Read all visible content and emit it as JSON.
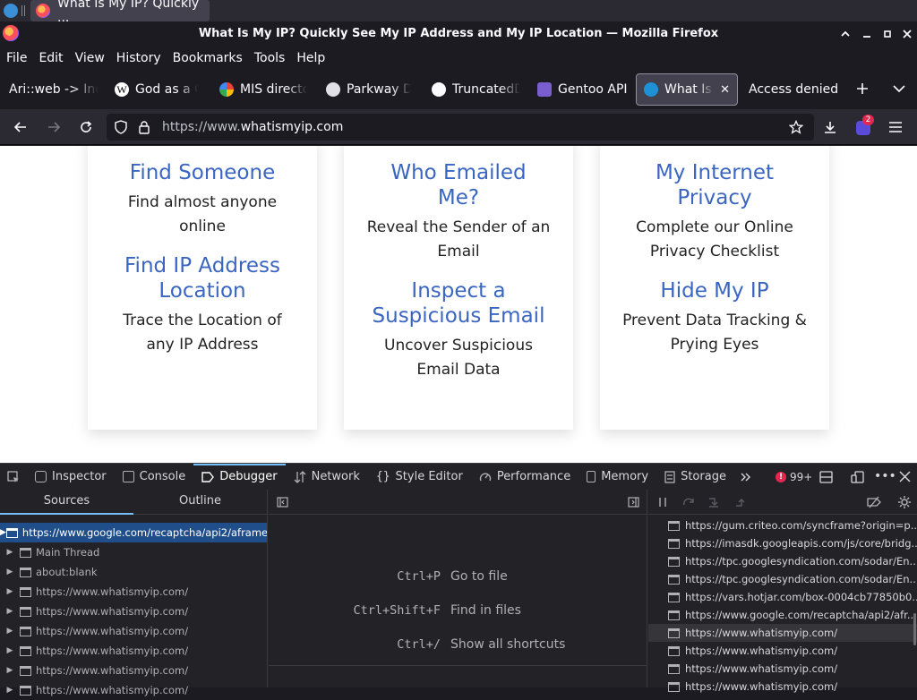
{
  "taskbar": {
    "task_title": "What Is My IP? Quickly ..."
  },
  "window": {
    "title": "What Is My IP? Quickly See My IP Address and My IP Location — Mozilla Firefox"
  },
  "menu": [
    "File",
    "Edit",
    "View",
    "History",
    "Bookmarks",
    "Tools",
    "Help"
  ],
  "tabs": [
    {
      "label": "Ari::web -> Ind"
    },
    {
      "label": "God as a C"
    },
    {
      "label": "MIS directo"
    },
    {
      "label": "Parkway Di"
    },
    {
      "label": "TruncatedD"
    },
    {
      "label": "Gentoo API"
    },
    {
      "label": "What Is M"
    },
    {
      "label": "Access denied"
    }
  ],
  "nav": {
    "url_prefix": "https://www.",
    "url_domain": "whatismyip.com",
    "extension_badge": "2"
  },
  "cards": [
    {
      "items": [
        {
          "heading": "Find Someone",
          "text": "Find almost anyone online"
        },
        {
          "heading": "Find IP Address Location",
          "text": "Trace the Location of any IP Address"
        }
      ]
    },
    {
      "items": [
        {
          "heading": "Who Emailed Me?",
          "text": "Reveal the Sender of an Email"
        },
        {
          "heading": "Inspect a Suspicious Email",
          "text": "Uncover Suspicious Email Data"
        }
      ]
    },
    {
      "items": [
        {
          "heading": "My Internet Privacy",
          "text": "Complete our Online Privacy Checklist"
        },
        {
          "heading": "Hide My IP",
          "text": "Prevent Data Tracking & Prying Eyes"
        }
      ]
    }
  ],
  "devtools": {
    "tabs": [
      "Inspector",
      "Console",
      "Debugger",
      "Network",
      "Style Editor",
      "Performance",
      "Memory",
      "Storage"
    ],
    "error_count": "99+",
    "left_tabs": [
      "Sources",
      "Outline"
    ],
    "sources": [
      "https://www.google.com/recaptcha/api2/aframe",
      "Main Thread",
      "about:blank",
      "https://www.whatismyip.com/",
      "https://www.whatismyip.com/",
      "https://www.whatismyip.com/",
      "https://www.whatismyip.com/",
      "https://www.whatismyip.com/",
      "https://www.whatismyip.com/"
    ],
    "shortcuts": [
      {
        "key": "Ctrl+P",
        "label": "Go to file"
      },
      {
        "key": "Ctrl+Shift+F",
        "label": "Find in files"
      },
      {
        "key": "Ctrl+/",
        "label": "Show all shortcuts"
      }
    ],
    "threads": [
      "https://gum.criteo.com/syncframe?origin=p...",
      "https://imasdk.googleapis.com/js/core/bridg...",
      "https://tpc.googlesyndication.com/sodar/En...",
      "https://tpc.googlesyndication.com/sodar/En...",
      "https://vars.hotjar.com/box-0004cb77850b0...",
      "https://www.google.com/recaptcha/api2/afr...",
      "https://www.whatismyip.com/",
      "https://www.whatismyip.com/",
      "https://www.whatismyip.com/",
      "https://www.whatismyip.com/"
    ]
  }
}
